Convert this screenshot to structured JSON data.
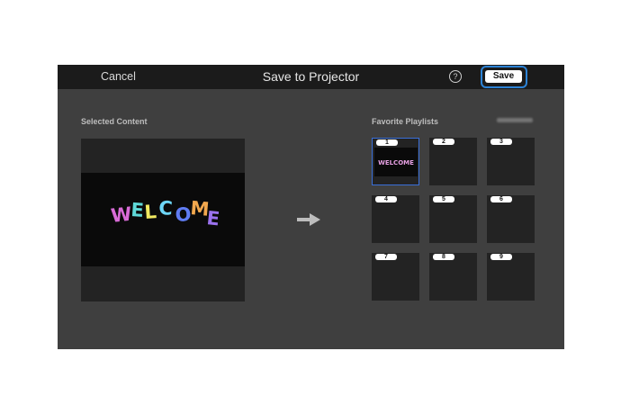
{
  "header": {
    "cancel_label": "Cancel",
    "title": "Save to Projector",
    "help_label": "?",
    "save_label": "Save"
  },
  "selected_content": {
    "label": "Selected Content",
    "preview_text": "WELCOME",
    "letter_colors": [
      "#d86bd6",
      "#5fd9d8",
      "#f2ea61",
      "#6dd6f7",
      "#5f7cf2",
      "#f2a84e",
      "#9b72ee"
    ]
  },
  "favorites": {
    "label": "Favorite Playlists",
    "slots": [
      {
        "number": "1",
        "has_content": true,
        "selected": true
      },
      {
        "number": "2",
        "has_content": false,
        "selected": false
      },
      {
        "number": "3",
        "has_content": false,
        "selected": false
      },
      {
        "number": "4",
        "has_content": false,
        "selected": false
      },
      {
        "number": "5",
        "has_content": false,
        "selected": false
      },
      {
        "number": "6",
        "has_content": false,
        "selected": false
      },
      {
        "number": "7",
        "has_content": false,
        "selected": false
      },
      {
        "number": "8",
        "has_content": false,
        "selected": false
      },
      {
        "number": "9",
        "has_content": false,
        "selected": false
      }
    ]
  },
  "colors": {
    "accent": "#2d83d6",
    "selection": "#3a6fd8"
  }
}
